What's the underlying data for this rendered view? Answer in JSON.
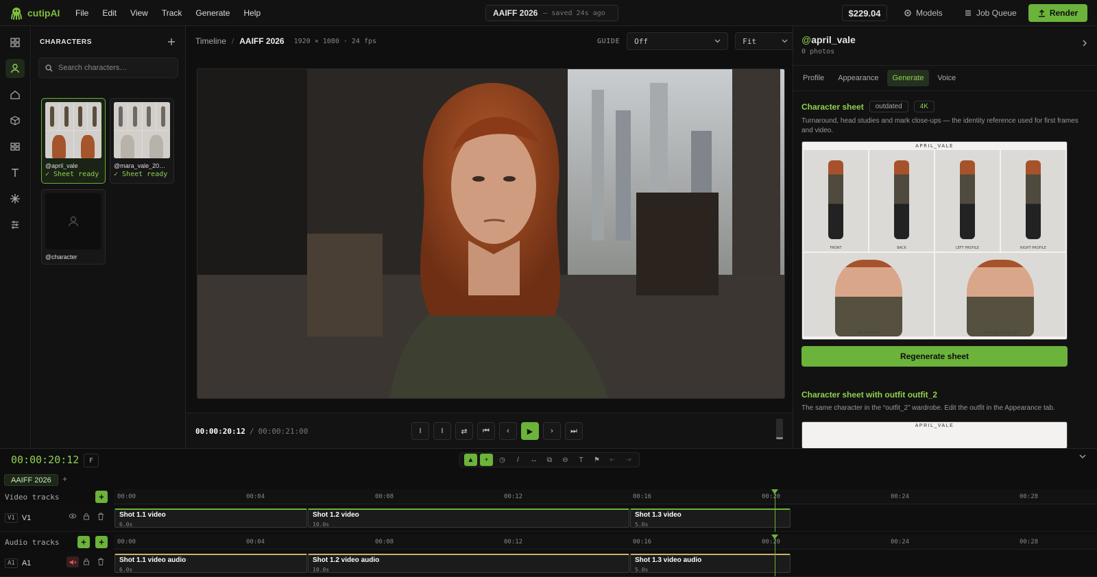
{
  "app": {
    "name": "cutipAI",
    "menu": [
      "File",
      "Edit",
      "View",
      "Track",
      "Generate",
      "Help"
    ]
  },
  "project": {
    "name": "AAIFF 2026",
    "saved": "— saved 24s ago"
  },
  "topbar": {
    "balance": "$229.04",
    "models": "Models",
    "job_queue": "Job Queue",
    "render": "Render"
  },
  "characters_panel": {
    "title": "CHARACTERS",
    "search_placeholder": "Search characters…",
    "cards": [
      {
        "handle": "@april_vale",
        "status": "✓ Sheet ready"
      },
      {
        "handle": "@mara_vale_20…",
        "status": "✓ Sheet ready"
      },
      {
        "handle": "@character",
        "status": ""
      }
    ]
  },
  "viewer": {
    "breadcrumb_root": "Timeline",
    "project": "AAIFF 2026",
    "resolution": "1920 × 1080 · 24 fps",
    "guide_label": "GUIDE",
    "guide_value": "Off",
    "zoom_value": "Fit",
    "timecode_current": "00:00:20:12",
    "timecode_total": "00:00:21:00"
  },
  "inspector": {
    "handle_at": "@",
    "handle": "april_vale",
    "photos": "0 photos",
    "tabs": [
      "Profile",
      "Appearance",
      "Generate",
      "Voice"
    ],
    "active_tab": "Generate",
    "sheet": {
      "title": "Character sheet",
      "badge_status": "outdated",
      "badge_res": "4K",
      "description": "Turnaround, head studies and mark close-ups — the identity reference used for first frames and video.",
      "sheet_label": "APRIL_VALE",
      "captions": [
        "FRONT",
        "BACK",
        "LEFT PROFILE",
        "RIGHT PROFILE",
        "3/4 PORTRAIT",
        "NEUTRAL CLOSE-UP"
      ],
      "button": "Regenerate sheet"
    },
    "outfit_sheet": {
      "title": "Character sheet with outfit outfit_2",
      "description": "The same character in the “outfit_2” wardrobe. Edit the outfit in the Appearance tab.",
      "sheet_label": "APRIL_VALE"
    }
  },
  "timeline": {
    "timecode": "00:00:20:12",
    "frame_btn": "F",
    "sequence_tab": "AAIFF 2026",
    "video_tracks_label": "Video tracks",
    "audio_tracks_label": "Audio tracks",
    "ruler_labels": [
      "00:00",
      "00:04",
      "00:08",
      "00:12",
      "00:16",
      "00:20",
      "00:24",
      "00:28"
    ],
    "video_track": {
      "tag": "V1",
      "name": "V1"
    },
    "audio_track": {
      "tag": "A1",
      "name": "A1"
    },
    "video_clips": [
      {
        "name": "Shot 1.1 video",
        "duration": "6.0s"
      },
      {
        "name": "Shot 1.2 video",
        "duration": "10.0s"
      },
      {
        "name": "Shot 1.3 video",
        "duration": "5.0s"
      }
    ],
    "audio_clips": [
      {
        "name": "Shot 1.1 video audio",
        "duration": "6.0s"
      },
      {
        "name": "Shot 1.2 video audio",
        "duration": "10.0s"
      },
      {
        "name": "Shot 1.3 video audio",
        "duration": "5.0s"
      }
    ]
  },
  "colors": {
    "accent": "#6bb33a",
    "accent_text": "#8fd151",
    "background": "#0d0d0d"
  }
}
